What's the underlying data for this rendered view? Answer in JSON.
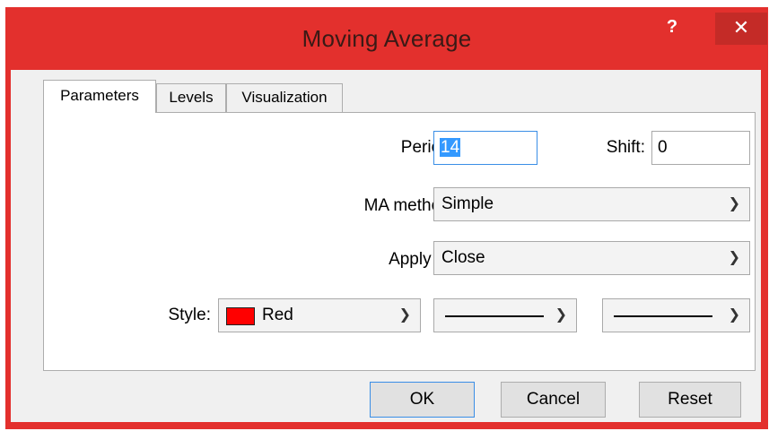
{
  "window": {
    "title": "Moving Average",
    "help_label": "?",
    "close_label": "✕"
  },
  "tabs": [
    {
      "label": "Parameters",
      "active": true
    },
    {
      "label": "Levels",
      "active": false
    },
    {
      "label": "Visualization",
      "active": false
    }
  ],
  "params": {
    "period_label": "Period:",
    "period_value": "14",
    "shift_label": "Shift:",
    "shift_value": "0",
    "method_label": "MA method:",
    "method_value": "Simple",
    "apply_label": "Apply to:",
    "apply_value": "Close",
    "style_label": "Style:",
    "style_color_name": "Red",
    "style_color": "#ff0000"
  },
  "buttons": {
    "ok": "OK",
    "cancel": "Cancel",
    "reset": "Reset"
  },
  "colors": {
    "titlebar": "#e3302d",
    "close_button": "#c42b27",
    "focus_border": "#3a8ee6"
  },
  "icons": {
    "dropdown": "chevron-down-icon",
    "close": "close-icon",
    "help": "help-icon"
  }
}
